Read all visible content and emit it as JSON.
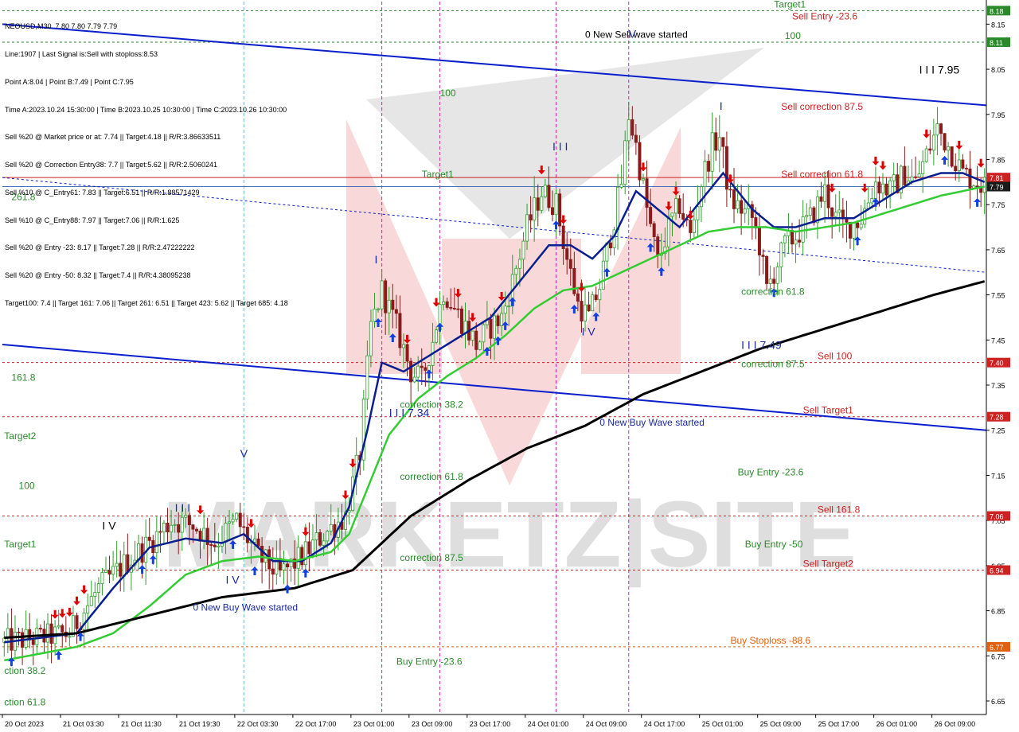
{
  "header": {
    "symbol_line": "NEOUSD,M30  7.80 7.80 7.79 7.79",
    "info_lines": [
      "Line:1907 | Last Signal is:Sell with stoploss:8.53",
      "Point A:8.04 | Point B:7.49 | Point C:7.95",
      "Time A:2023.10.24 15:30:00 | Time B:2023.10.25 10:30:00 | Time C:2023.10.26 10:30:00",
      "Sell %20 @ Market price or at: 7.74 || Target:4.18 || R/R:3.86633511",
      "Sell %20 @ Correction Entry38: 7.7 || Target:5.62 || R/R:2.5060241",
      "Sell %10 @ C_Entry61: 7.83 || Target:6.51 || R/R:1.88571429",
      "Sell %10 @ C_Entry88: 7.97 || Target:7.06 || R/R:1.625",
      "Sell %20 @ Entry -23: 8.17 || Target:7.28 || R/R:2.47222222",
      "Sell %20 @ Entry -50: 8.32 || Target:7.4 || R/R:4.38095238",
      "Target100: 7.4 || Target 161: 7.06 || Target 261: 6.51 || Target 423: 5.62 || Target 685: 4.18"
    ]
  },
  "colors": {
    "background": "#ffffff",
    "candle_up": "#2e9e2e",
    "candle_down": "#8b1a1a",
    "ma_fast": "#0a1f8f",
    "ma_mid": "#33cc33",
    "ma_slow": "#000000",
    "channel": "#0a1fcc",
    "level_red": "#cc2222",
    "level_green": "#2a8a2a",
    "current_price_line": "#4a6fb5",
    "arrow_sell": "#e00000",
    "arrow_buy": "#1040e0",
    "wave_label": "#1a2aa0",
    "watermark_pink": "#f2b8b8"
  },
  "chart_data": {
    "type": "candlestick",
    "symbol": "NEOUSD",
    "timeframe": "M30",
    "ylim": [
      6.62,
      8.2
    ],
    "y_ticks": [
      6.65,
      6.75,
      6.85,
      6.95,
      7.05,
      7.15,
      7.25,
      7.35,
      7.45,
      7.55,
      7.65,
      7.75,
      7.85,
      7.95,
      8.05,
      8.15
    ],
    "x_ticks": [
      {
        "index": 0,
        "label": "20 Oct 2023"
      },
      {
        "index": 16,
        "label": "21 Oct 03:30"
      },
      {
        "index": 32,
        "label": "21 Oct 11:30"
      },
      {
        "index": 48,
        "label": "21 Oct 19:30"
      },
      {
        "index": 64,
        "label": "22 Oct 03:30"
      },
      {
        "index": 80,
        "label": "22 Oct 17:00"
      },
      {
        "index": 96,
        "label": "23 Oct 01:00"
      },
      {
        "index": 112,
        "label": "23 Oct 09:00"
      },
      {
        "index": 128,
        "label": "23 Oct 17:00"
      },
      {
        "index": 144,
        "label": "24 Oct 01:00"
      },
      {
        "index": 160,
        "label": "24 Oct 09:00"
      },
      {
        "index": 176,
        "label": "24 Oct 17:00"
      },
      {
        "index": 192,
        "label": "25 Oct 01:00"
      },
      {
        "index": 208,
        "label": "25 Oct 09:00"
      },
      {
        "index": 224,
        "label": "25 Oct 17:00"
      },
      {
        "index": 240,
        "label": "26 Oct 01:00"
      },
      {
        "index": 256,
        "label": "26 Oct 09:00"
      }
    ],
    "candle_count": 271,
    "close_anchors": [
      [
        0,
        6.78
      ],
      [
        10,
        6.79
      ],
      [
        18,
        6.8
      ],
      [
        26,
        6.9
      ],
      [
        34,
        6.96
      ],
      [
        40,
        7.0
      ],
      [
        46,
        7.05
      ],
      [
        52,
        7.04
      ],
      [
        58,
        7.0
      ],
      [
        64,
        7.05
      ],
      [
        70,
        6.97
      ],
      [
        76,
        6.93
      ],
      [
        82,
        6.97
      ],
      [
        88,
        7.02
      ],
      [
        94,
        7.06
      ],
      [
        98,
        7.2
      ],
      [
        101,
        7.48
      ],
      [
        104,
        7.56
      ],
      [
        108,
        7.48
      ],
      [
        112,
        7.38
      ],
      [
        115,
        7.36
      ],
      [
        118,
        7.45
      ],
      [
        121,
        7.56
      ],
      [
        124,
        7.52
      ],
      [
        127,
        7.48
      ],
      [
        130,
        7.44
      ],
      [
        134,
        7.48
      ],
      [
        137,
        7.5
      ],
      [
        140,
        7.58
      ],
      [
        144,
        7.7
      ],
      [
        148,
        7.78
      ],
      [
        152,
        7.75
      ],
      [
        155,
        7.63
      ],
      [
        158,
        7.53
      ],
      [
        161,
        7.5
      ],
      [
        164,
        7.57
      ],
      [
        168,
        7.72
      ],
      [
        170,
        7.8
      ],
      [
        172,
        7.95
      ],
      [
        174,
        7.88
      ],
      [
        177,
        7.74
      ],
      [
        180,
        7.62
      ],
      [
        183,
        7.7
      ],
      [
        186,
        7.75
      ],
      [
        189,
        7.68
      ],
      [
        192,
        7.8
      ],
      [
        195,
        7.88
      ],
      [
        197,
        7.9
      ],
      [
        200,
        7.76
      ],
      [
        203,
        7.74
      ],
      [
        206,
        7.72
      ],
      [
        208,
        7.66
      ],
      [
        210,
        7.56
      ],
      [
        212,
        7.6
      ],
      [
        215,
        7.66
      ],
      [
        218,
        7.68
      ],
      [
        222,
        7.72
      ],
      [
        226,
        7.78
      ],
      [
        229,
        7.72
      ],
      [
        232,
        7.7
      ],
      [
        236,
        7.72
      ],
      [
        240,
        7.8
      ],
      [
        244,
        7.78
      ],
      [
        248,
        7.82
      ],
      [
        251,
        7.8
      ],
      [
        254,
        7.86
      ],
      [
        257,
        7.92
      ],
      [
        260,
        7.88
      ],
      [
        264,
        7.82
      ],
      [
        268,
        7.8
      ],
      [
        270,
        7.79
      ]
    ],
    "series": [
      {
        "name": "",
        "role": "fast_ma",
        "values_at": [
          [
            0,
            6.78
          ],
          [
            20,
            6.8
          ],
          [
            30,
            6.9
          ],
          [
            40,
            6.99
          ],
          [
            50,
            7.01
          ],
          [
            60,
            7.0
          ],
          [
            66,
            7.02
          ],
          [
            74,
            6.96
          ],
          [
            82,
            6.96
          ],
          [
            90,
            7.0
          ],
          [
            95,
            7.08
          ],
          [
            100,
            7.25
          ],
          [
            104,
            7.4
          ],
          [
            110,
            7.38
          ],
          [
            118,
            7.42
          ],
          [
            126,
            7.46
          ],
          [
            134,
            7.5
          ],
          [
            142,
            7.58
          ],
          [
            150,
            7.66
          ],
          [
            156,
            7.66
          ],
          [
            162,
            7.63
          ],
          [
            168,
            7.68
          ],
          [
            174,
            7.78
          ],
          [
            180,
            7.74
          ],
          [
            186,
            7.7
          ],
          [
            192,
            7.76
          ],
          [
            198,
            7.82
          ],
          [
            206,
            7.74
          ],
          [
            212,
            7.7
          ],
          [
            218,
            7.7
          ],
          [
            226,
            7.72
          ],
          [
            234,
            7.72
          ],
          [
            242,
            7.76
          ],
          [
            250,
            7.8
          ],
          [
            258,
            7.82
          ],
          [
            264,
            7.82
          ],
          [
            270,
            7.8
          ]
        ]
      },
      {
        "name": "",
        "role": "mid_ma",
        "values_at": [
          [
            0,
            6.74
          ],
          [
            20,
            6.77
          ],
          [
            30,
            6.8
          ],
          [
            40,
            6.86
          ],
          [
            50,
            6.93
          ],
          [
            60,
            6.96
          ],
          [
            70,
            6.97
          ],
          [
            80,
            6.96
          ],
          [
            90,
            6.98
          ],
          [
            95,
            7.02
          ],
          [
            100,
            7.12
          ],
          [
            106,
            7.24
          ],
          [
            114,
            7.32
          ],
          [
            122,
            7.37
          ],
          [
            130,
            7.41
          ],
          [
            138,
            7.46
          ],
          [
            146,
            7.52
          ],
          [
            154,
            7.56
          ],
          [
            162,
            7.57
          ],
          [
            170,
            7.6
          ],
          [
            178,
            7.63
          ],
          [
            186,
            7.66
          ],
          [
            194,
            7.69
          ],
          [
            202,
            7.7
          ],
          [
            210,
            7.7
          ],
          [
            218,
            7.69
          ],
          [
            226,
            7.7
          ],
          [
            234,
            7.71
          ],
          [
            242,
            7.73
          ],
          [
            250,
            7.75
          ],
          [
            258,
            7.77
          ],
          [
            264,
            7.78
          ],
          [
            270,
            7.79
          ]
        ]
      },
      {
        "name": "",
        "role": "slow_ma",
        "values_at": [
          [
            0,
            6.79
          ],
          [
            20,
            6.8
          ],
          [
            40,
            6.84
          ],
          [
            60,
            6.88
          ],
          [
            80,
            6.9
          ],
          [
            96,
            6.94
          ],
          [
            112,
            7.06
          ],
          [
            128,
            7.14
          ],
          [
            144,
            7.21
          ],
          [
            160,
            7.26
          ],
          [
            176,
            7.33
          ],
          [
            192,
            7.38
          ],
          [
            208,
            7.43
          ],
          [
            224,
            7.47
          ],
          [
            240,
            7.51
          ],
          [
            256,
            7.55
          ],
          [
            270,
            7.58
          ]
        ]
      },
      {
        "name": "",
        "role": "channel_upper",
        "values_at": [
          [
            0,
            8.15
          ],
          [
            270,
            7.97
          ]
        ]
      },
      {
        "name": "",
        "role": "channel_lower",
        "values_at": [
          [
            0,
            7.44
          ],
          [
            270,
            7.25
          ]
        ]
      },
      {
        "name": "",
        "role": "channel_mid_dotted",
        "values_at": [
          [
            0,
            7.81
          ],
          [
            270,
            7.6
          ]
        ]
      }
    ],
    "levels": [
      {
        "price": 8.18,
        "label": "Target1",
        "color": "#2a8a2a",
        "style": "dotted",
        "tag": "8.18",
        "label_index": 212
      },
      {
        "price": 8.11,
        "label": "100",
        "color": "#2a8a2a",
        "style": "dotted",
        "tag": "8.11",
        "label_index": 215
      },
      {
        "price": 7.81,
        "label": "",
        "color": "#cc2222",
        "style": "solid",
        "tag": "7.81",
        "label_index": 0
      },
      {
        "price": 7.4,
        "label": "Sell 100",
        "color": "#cc2222",
        "style": "dotted",
        "tag": "7.40",
        "label_index": 224
      },
      {
        "price": 7.28,
        "label": "Sell Target1",
        "color": "#cc2222",
        "style": "dotted",
        "tag": "7.28",
        "label_index": 220
      },
      {
        "price": 7.06,
        "label": "Sell 161.8",
        "color": "#cc2222",
        "style": "dotted",
        "tag": "7.06",
        "label_index": 224
      },
      {
        "price": 6.94,
        "label": "Sell Target2",
        "color": "#cc2222",
        "style": "dotted",
        "tag": "6.94",
        "label_index": 220
      },
      {
        "price": 6.77,
        "label": "Buy Stoploss -88.6",
        "color": "#e06010",
        "style": "dotted",
        "tag": "6.77",
        "label_index": 200
      }
    ],
    "current_price": {
      "price": 7.79,
      "tag": "7.79"
    },
    "annotations": [
      {
        "text": "Sell Entry -23.6",
        "index": 217,
        "price": 8.16,
        "color": "#cc2222"
      },
      {
        "text": "0 New Sell wave started",
        "index": 160,
        "price": 8.12,
        "color": "#000000"
      },
      {
        "text": "I I I 7.95",
        "index": 252,
        "price": 8.04,
        "color": "#000000"
      },
      {
        "text": "100",
        "index": 120,
        "price": 7.99,
        "color": "#2a8a2a"
      },
      {
        "text": "Sell correction 87.5",
        "index": 214,
        "price": 7.96,
        "color": "#cc2222"
      },
      {
        "text": "Sell correction 61.8",
        "index": 214,
        "price": 7.81,
        "color": "#cc2222"
      },
      {
        "text": "Target1",
        "index": 115,
        "price": 7.81,
        "color": "#2a8a2a"
      },
      {
        "text": "261.8",
        "index": 2,
        "price": 7.76,
        "color": "#2a8a2a"
      },
      {
        "text": "correction 61.8",
        "index": 203,
        "price": 7.55,
        "color": "#2a8a2a"
      },
      {
        "text": "I I I 7.49",
        "index": 203,
        "price": 7.43,
        "color": "#1a2aa0"
      },
      {
        "text": "correction 87.5",
        "index": 203,
        "price": 7.39,
        "color": "#2a8a2a"
      },
      {
        "text": "161.8",
        "index": 2,
        "price": 7.36,
        "color": "#2a8a2a"
      },
      {
        "text": "correction 38.2",
        "index": 109,
        "price": 7.3,
        "color": "#2a8a2a"
      },
      {
        "text": "I I I 7.34",
        "index": 106,
        "price": 7.28,
        "color": "#1a2aa0"
      },
      {
        "text": "0 New Buy Wave started",
        "index": 164,
        "price": 7.26,
        "color": "#1a2aa0"
      },
      {
        "text": "Target2",
        "index": 0,
        "price": 7.23,
        "color": "#2a8a2a"
      },
      {
        "text": "Buy Entry -23.6",
        "index": 202,
        "price": 7.15,
        "color": "#2a8a2a"
      },
      {
        "text": "correction 61.8",
        "index": 109,
        "price": 7.14,
        "color": "#2a8a2a"
      },
      {
        "text": "100",
        "index": 4,
        "price": 7.12,
        "color": "#2a8a2a"
      },
      {
        "text": "Buy Entry -50",
        "index": 204,
        "price": 6.99,
        "color": "#2a8a2a"
      },
      {
        "text": "Target1",
        "index": 0,
        "price": 6.99,
        "color": "#2a8a2a"
      },
      {
        "text": "correction 87.5",
        "index": 109,
        "price": 6.96,
        "color": "#2a8a2a"
      },
      {
        "text": "0 New Buy Wave started",
        "index": 52,
        "price": 6.85,
        "color": "#1a2aa0"
      },
      {
        "text": "Buy Entry -23.6",
        "index": 108,
        "price": 6.73,
        "color": "#2a8a2a"
      },
      {
        "text": "ction 38.2",
        "index": 0,
        "price": 6.71,
        "color": "#2a8a2a"
      },
      {
        "text": "ction 61.8",
        "index": 0,
        "price": 6.64,
        "color": "#2a8a2a"
      },
      {
        "text": "I",
        "index": 102,
        "price": 7.62,
        "color": "#1a2aa0"
      },
      {
        "text": "I I I",
        "index": 151,
        "price": 7.87,
        "color": "#1a2aa0"
      },
      {
        "text": "I V",
        "index": 159,
        "price": 7.46,
        "color": "#1a2aa0"
      },
      {
        "text": "V",
        "index": 172,
        "price": 8.12,
        "color": "#1a2aa0"
      },
      {
        "text": "I",
        "index": 197,
        "price": 7.96,
        "color": "#1a2aa0"
      },
      {
        "text": "I I I",
        "index": 47,
        "price": 7.07,
        "color": "#1a2aa0"
      },
      {
        "text": "V",
        "index": 65,
        "price": 7.19,
        "color": "#1a2aa0"
      },
      {
        "text": "I V",
        "index": 61,
        "price": 6.91,
        "color": "#1a2aa0"
      },
      {
        "text": "I V",
        "index": 27,
        "price": 7.03,
        "color": "#000000"
      }
    ],
    "sell_arrow_indices": [
      14,
      16,
      18,
      20,
      22,
      54,
      68,
      83,
      94,
      96,
      111,
      119,
      125,
      129,
      137,
      148,
      154,
      159,
      176,
      183,
      185,
      189,
      200,
      228,
      237,
      240,
      242,
      254,
      263,
      269
    ],
    "buy_arrow_indices": [
      2,
      15,
      21,
      38,
      41,
      63,
      69,
      78,
      83,
      103,
      107,
      117,
      120,
      133,
      136,
      138,
      140,
      152,
      157,
      163,
      166,
      178,
      181,
      212,
      235,
      240,
      259,
      268
    ],
    "vertical_markers": [
      {
        "index": 104,
        "color": "#cc2a9a"
      },
      {
        "index": 120,
        "color": "#cc2a9a"
      },
      {
        "index": 152,
        "color": "#cc2a9a"
      },
      {
        "index": 172,
        "color": "#cc2a9a"
      },
      {
        "index": 66,
        "color": "#6fb5e0"
      }
    ]
  },
  "watermark": {
    "text": "MARKETZ|SITE"
  }
}
